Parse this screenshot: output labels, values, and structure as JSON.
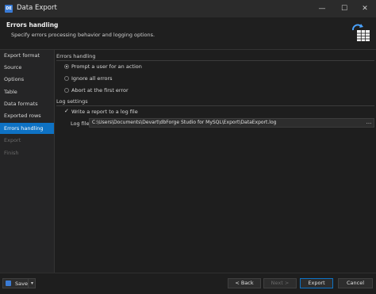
{
  "window": {
    "title": "Data Export",
    "icon_text": "DE"
  },
  "header": {
    "title": "Errors handling",
    "subtitle": "Specify errors processing behavior and logging options."
  },
  "sidebar": {
    "items": [
      {
        "label": "Export format",
        "state": "normal"
      },
      {
        "label": "Source",
        "state": "normal"
      },
      {
        "label": "Options",
        "state": "normal"
      },
      {
        "label": "Table",
        "state": "normal"
      },
      {
        "label": "Data formats",
        "state": "normal"
      },
      {
        "label": "Exported rows",
        "state": "normal"
      },
      {
        "label": "Errors handling",
        "state": "active"
      },
      {
        "label": "Export",
        "state": "disabled"
      },
      {
        "label": "Finish",
        "state": "disabled"
      }
    ]
  },
  "errors_section": {
    "title": "Errors handling",
    "options": [
      {
        "label": "Prompt a user for an action",
        "selected": true
      },
      {
        "label": "Ignore all errors",
        "selected": false
      },
      {
        "label": "Abort at the first error",
        "selected": false
      }
    ]
  },
  "log_section": {
    "title": "Log settings",
    "write_report_label": "Write a report to a log file",
    "write_report_checked": true,
    "log_file_label": "Log file:",
    "log_file_value": "C:\\Users\\Documents\\Devart\\dbForge Studio for MySQL\\Export\\DataExport.log",
    "browse_label": "..."
  },
  "footer": {
    "save_label": "Save",
    "back_label": "< Back",
    "next_label": "Next >",
    "export_label": "Export",
    "cancel_label": "Cancel"
  },
  "colors": {
    "accent": "#0e72c4",
    "background": "#1e1e1e",
    "sidebar": "#252526"
  }
}
